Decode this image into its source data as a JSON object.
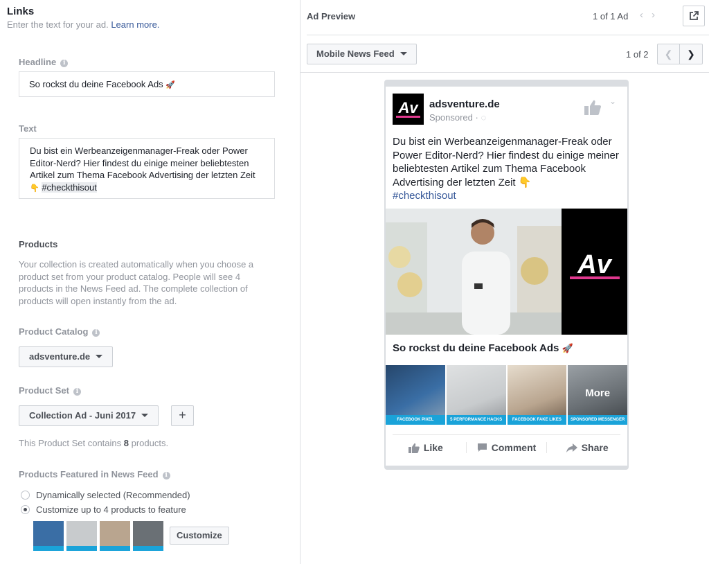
{
  "left": {
    "links_title": "Links",
    "links_subtitle": "Enter the text for your ad.",
    "learn_more": "Learn more.",
    "headline_label": "Headline",
    "headline_value": "So rockst du deine Facebook Ads",
    "text_label": "Text",
    "text_value": "Du bist ein Werbeanzeigenmanager-Freak oder Power Editor-Nerd? Hier findest du einige meiner beliebtesten Artikel zum Thema Facebook Advertising der letzten Zeit",
    "text_hashtag": "#checkthisout",
    "products_title": "Products",
    "products_desc": "Your collection is created automatically when you choose a product set from your product catalog. People will see 4 products in the News Feed ad. The complete collection of products will open instantly from the ad.",
    "catalog_label": "Product Catalog",
    "catalog_value": "adsventure.de",
    "set_label": "Product Set",
    "set_value": "Collection Ad - Juni 2017",
    "set_note_pre": "This Product Set contains",
    "set_note_count": "8",
    "set_note_post": "products.",
    "featured_label": "Products Featured in News Feed",
    "radio_dynamic": "Dynamically selected (Recommended)",
    "radio_custom": "Customize up to 4 products to feature",
    "customize_button": "Customize"
  },
  "right": {
    "title": "Ad Preview",
    "ad_count": "1 of 1 Ad",
    "placement": "Mobile News Feed",
    "page_count": "1 of 2"
  },
  "ad": {
    "page_name": "adsventure.de",
    "sponsored": "Sponsored ·",
    "avatar_text": "Av",
    "body_text": "Du bist ein Werbeanzeigenmanager-Freak oder Power Editor-Nerd? Hier findest du einige meiner beliebtesten Artikel zum Thema Facebook Advertising der letzten Zeit",
    "hashtag": "#checkthisout",
    "hero_logo_text": "Av",
    "headline": "So rockst du deine Facebook Ads",
    "products": [
      {
        "label": "FACEBOOK PIXEL",
        "color": "#3a6ea5"
      },
      {
        "label": "5 PERFORMANCE HACKS",
        "color": "#c8cbcd"
      },
      {
        "label": "FACEBOOK FAKE LIKES",
        "color": "#b9a58f"
      },
      {
        "label": "SPONSORED MESSENGER ADS",
        "color": "#6a7075"
      }
    ],
    "more_label": "More",
    "action_like": "Like",
    "action_comment": "Comment",
    "action_share": "Share"
  },
  "colors": {
    "accent_blue": "#365899",
    "product_label_bg": "#1aa3d9",
    "brand_pink": "#e0388e"
  }
}
